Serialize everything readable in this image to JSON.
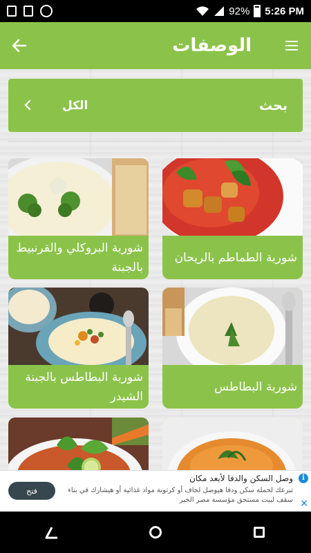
{
  "status_bar": {
    "battery": "92%",
    "time": "5:26 PM"
  },
  "app_bar": {
    "title": "الوصفات",
    "back_icon": "arrow-left-icon",
    "menu_icon": "hamburger-menu-icon"
  },
  "filter": {
    "category": "الكل",
    "search_label": "بحث",
    "chevron_icon": "chevron-left-icon"
  },
  "recipes": [
    {
      "title": "شوربة الطماطم بالريحان"
    },
    {
      "title": "شوربة البروكلي والقرنبيط بالجبنة"
    },
    {
      "title": "شوربة البطاطس"
    },
    {
      "title": "شوربة البطاطس بالجبنة الشيدر"
    },
    {
      "title": ""
    },
    {
      "title": ""
    }
  ],
  "ad": {
    "title": "وصل السكن والدفا لأبعد مكان",
    "body": "تبرعك لحملة سكن ودفا هيوصل لحاف أو كرتونة مواد غذائية أو هيشارك في بناء سقف لبيت مستحق مؤسسة مصر الخير",
    "button": "فتح",
    "info_icon": "info-icon",
    "close_icon": "close-icon"
  },
  "colors": {
    "primary": "#8bc34a",
    "ad_button": "#37474f",
    "ad_accent": "#1a8dd8"
  }
}
